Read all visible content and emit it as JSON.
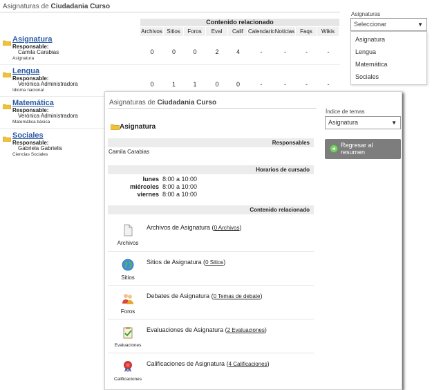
{
  "header": {
    "prefix": "Asignaturas de",
    "course": "Ciudadania Curso"
  },
  "table": {
    "group_title": "Contenido relacionado",
    "columns": [
      "Archivos",
      "Sitios",
      "Foros",
      "Eval",
      "Calif",
      "Calendario",
      "Noticias",
      "Faqs",
      "Wikis"
    ],
    "rows": [
      {
        "subject": "Asignatura",
        "responsable_label": "Responsable:",
        "responsable": "Camila Carabias",
        "subtitle": "Asignatura",
        "values": [
          "0",
          "0",
          "0",
          "2",
          "4",
          "-",
          "-",
          "-",
          "-"
        ]
      },
      {
        "subject": "Lengua",
        "responsable_label": "Responsable:",
        "responsable": "Verónica Administradora",
        "subtitle": "Idioma nacional",
        "values": [
          "0",
          "1",
          "1",
          "0",
          "0",
          "-",
          "-",
          "-",
          "-"
        ]
      },
      {
        "subject": "Matemática",
        "responsable_label": "Responsable:",
        "responsable": "Verónica Administradora",
        "subtitle": "Matemática básica"
      },
      {
        "subject": "Sociales",
        "responsable_label": "Responsable:",
        "responsable": "Gabriela Gabrielis",
        "subtitle": "Ciencias Sociales"
      }
    ]
  },
  "subject_select": {
    "label": "Asignaturas",
    "value": "Seleccionar",
    "options": [
      "Asignatura",
      "Lengua",
      "Matemática",
      "Sociales"
    ]
  },
  "detail": {
    "title_prefix": "Asignaturas de",
    "title_course": "Ciudadania Curso",
    "subject": "Asignatura",
    "responsables_title": "Responsables",
    "responsable": "Camila Carabias",
    "schedule_title": "Horarios de cursado",
    "schedule": [
      {
        "day": "lunes",
        "time": "8:00 a 10:00"
      },
      {
        "day": "miércoles",
        "time": "8:00 a 10:00"
      },
      {
        "day": "viernes",
        "time": "8:00 a 10:00"
      }
    ],
    "related_title": "Contenido relacionado",
    "items": [
      {
        "caption": "Archivos",
        "text": "Archivos de Asignatura (",
        "link": "0 Archivos",
        "close": ")"
      },
      {
        "caption": "Sitios",
        "text": "Sitios de Asignatura (",
        "link": "0 Sitios",
        "close": ")"
      },
      {
        "caption": "Foros",
        "text": "Debates de Asignatura (",
        "link": "0 Temas de debate",
        "close": ")"
      },
      {
        "caption": "Evaluaciones",
        "text": "Evaluaciones de Asignatura (",
        "link": "2 Evaluaciones",
        "close": ")"
      },
      {
        "caption": "Calificaciones",
        "text": "Calificaciones de Asignatura (",
        "link": "4 Calificaciones",
        "close": ")"
      }
    ],
    "index_label": "Índice de temas",
    "index_value": "Asignatura",
    "back_button": "Regresar al resumen"
  }
}
